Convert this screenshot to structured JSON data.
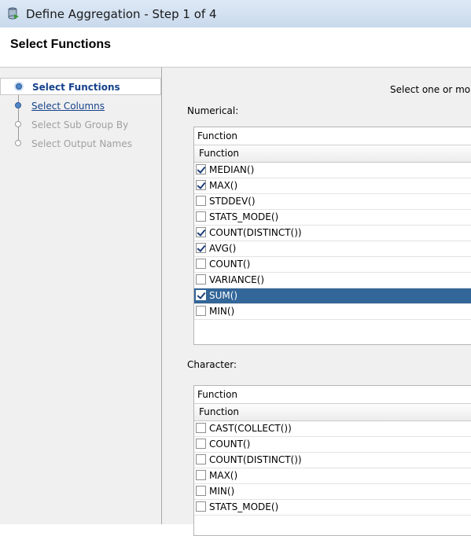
{
  "window": {
    "title": "Define Aggregation - Step 1 of 4"
  },
  "header": {
    "title": "Select Functions"
  },
  "nav": {
    "items": [
      {
        "label": "Select Functions",
        "state": "active"
      },
      {
        "label": "Select Columns",
        "state": "link"
      },
      {
        "label": "Select Sub Group By",
        "state": "disabled"
      },
      {
        "label": "Select Output Names",
        "state": "disabled"
      }
    ]
  },
  "main": {
    "instruction": "Select one or mor",
    "numerical": {
      "label": "Numerical:",
      "header1": "Function",
      "header2": "Function",
      "rows": [
        {
          "name": "MEDIAN()",
          "checked": true
        },
        {
          "name": "MAX()",
          "checked": true
        },
        {
          "name": "STDDEV()",
          "checked": false
        },
        {
          "name": "STATS_MODE()",
          "checked": false
        },
        {
          "name": "COUNT(DISTINCT())",
          "checked": true
        },
        {
          "name": "AVG()",
          "checked": true
        },
        {
          "name": "COUNT()",
          "checked": false
        },
        {
          "name": "VARIANCE()",
          "checked": false
        },
        {
          "name": "SUM()",
          "checked": true,
          "selected": true
        },
        {
          "name": "MIN()",
          "checked": false
        }
      ]
    },
    "character": {
      "label": "Character:",
      "header1": "Function",
      "header2": "Function",
      "rows": [
        {
          "name": "CAST(COLLECT())",
          "checked": false
        },
        {
          "name": "COUNT()",
          "checked": false
        },
        {
          "name": "COUNT(DISTINCT())",
          "checked": false
        },
        {
          "name": "MAX()",
          "checked": false
        },
        {
          "name": "MIN()",
          "checked": false
        },
        {
          "name": "STATS_MODE()",
          "checked": false
        }
      ]
    }
  },
  "colors": {
    "selected_row": "#336699",
    "nav_active": "#15428b"
  }
}
